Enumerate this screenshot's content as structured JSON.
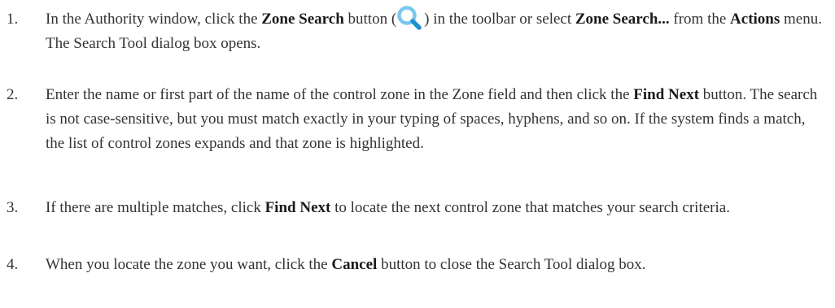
{
  "steps": [
    {
      "num": "1.",
      "t1": "In the Authority window, click the ",
      "b1": "Zone Search",
      "t2": " button (",
      "icon": "magnifier-icon",
      "t3": ") in the toolbar or select ",
      "b2": "Zone Search...",
      "t4": " from the ",
      "b3": "Actions",
      "t5": " menu. The Search Tool dialog box opens."
    },
    {
      "num": "2.",
      "t1": "Enter the name or first part of the name of the control zone in the Zone field and then click the ",
      "b1": "Find Next",
      "t2": " button. The search is not case-sensitive, but you must match exactly in your typing of spaces, hyphens, and so on. If the system finds a match, the list of control zones expands and that zone is highlighted."
    },
    {
      "num": "3.",
      "t1": "If there are multiple matches, click ",
      "b1": "Find Next",
      "t2": " to locate the next control zone that matches your search criteria."
    },
    {
      "num": "4.",
      "t1": "When you locate the zone you want, click the ",
      "b1": "Cancel",
      "t2": " button to close the Search Tool dialog box."
    }
  ],
  "colors": {
    "text": "#333333",
    "icon_ring": "#7cc7ee",
    "icon_handle": "#1e8fd1"
  }
}
